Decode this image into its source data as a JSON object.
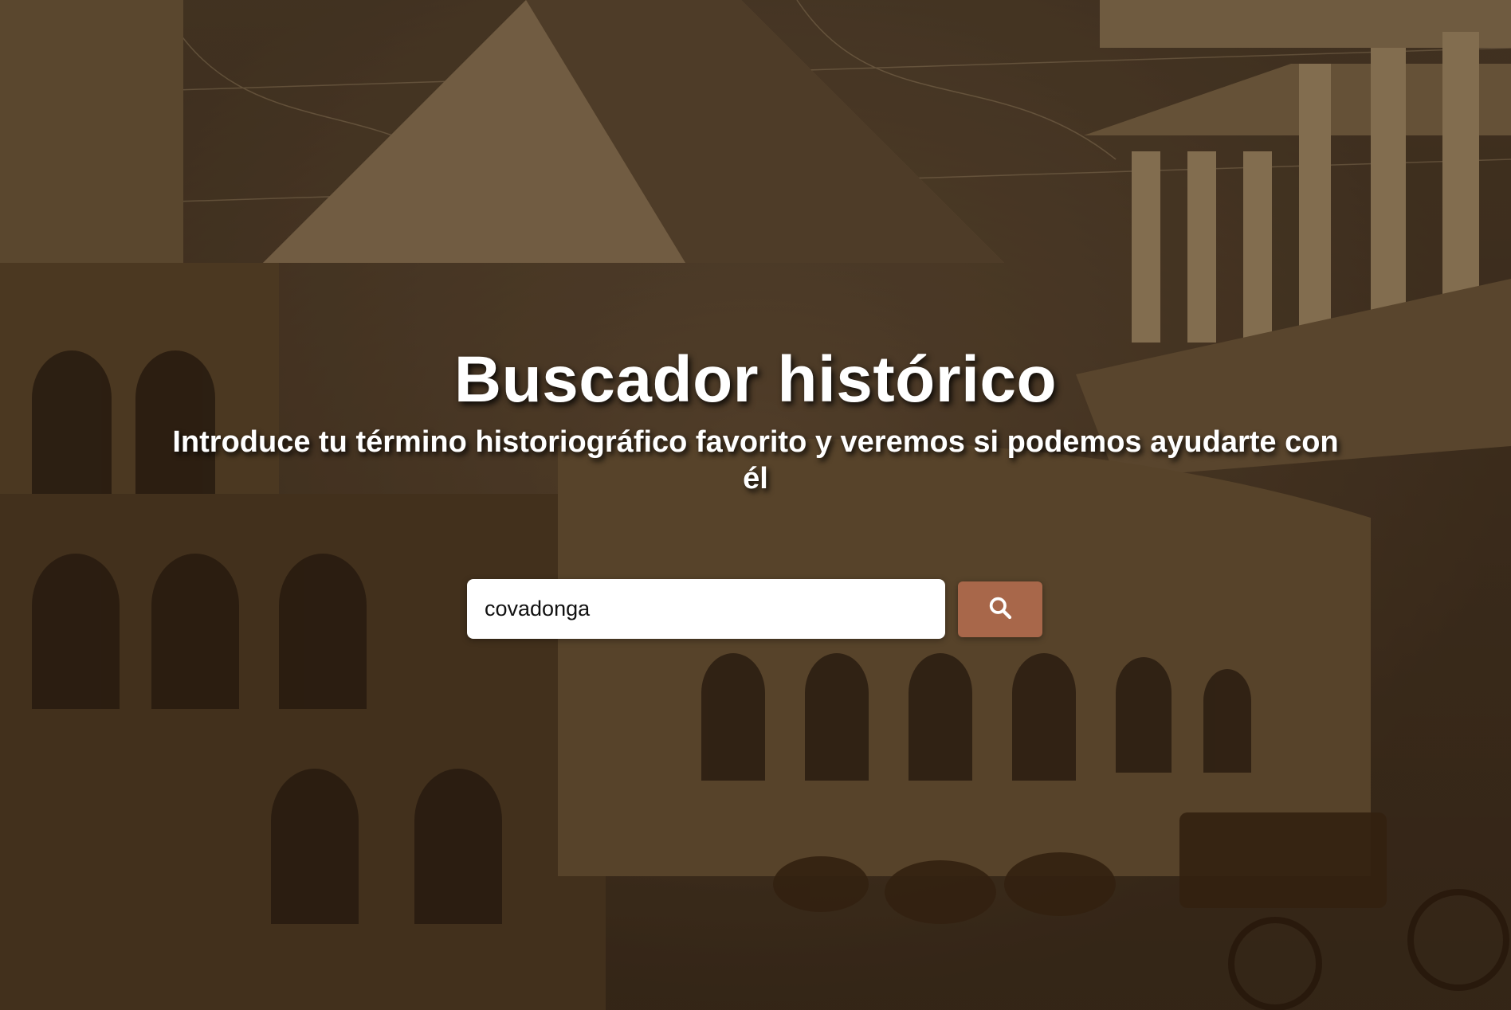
{
  "hero": {
    "title": "Buscador histórico",
    "subtitle": "Introduce tu término historiográfico favorito y veremos si podemos ayudarte con él"
  },
  "search": {
    "value": "covadonga",
    "placeholder": "",
    "button_icon": "search-icon",
    "button_color": "#a8674a"
  },
  "background": {
    "image": "sepia collage of ancient monuments: pyramid, Colosseum, Greek temple, horses and chariot"
  }
}
